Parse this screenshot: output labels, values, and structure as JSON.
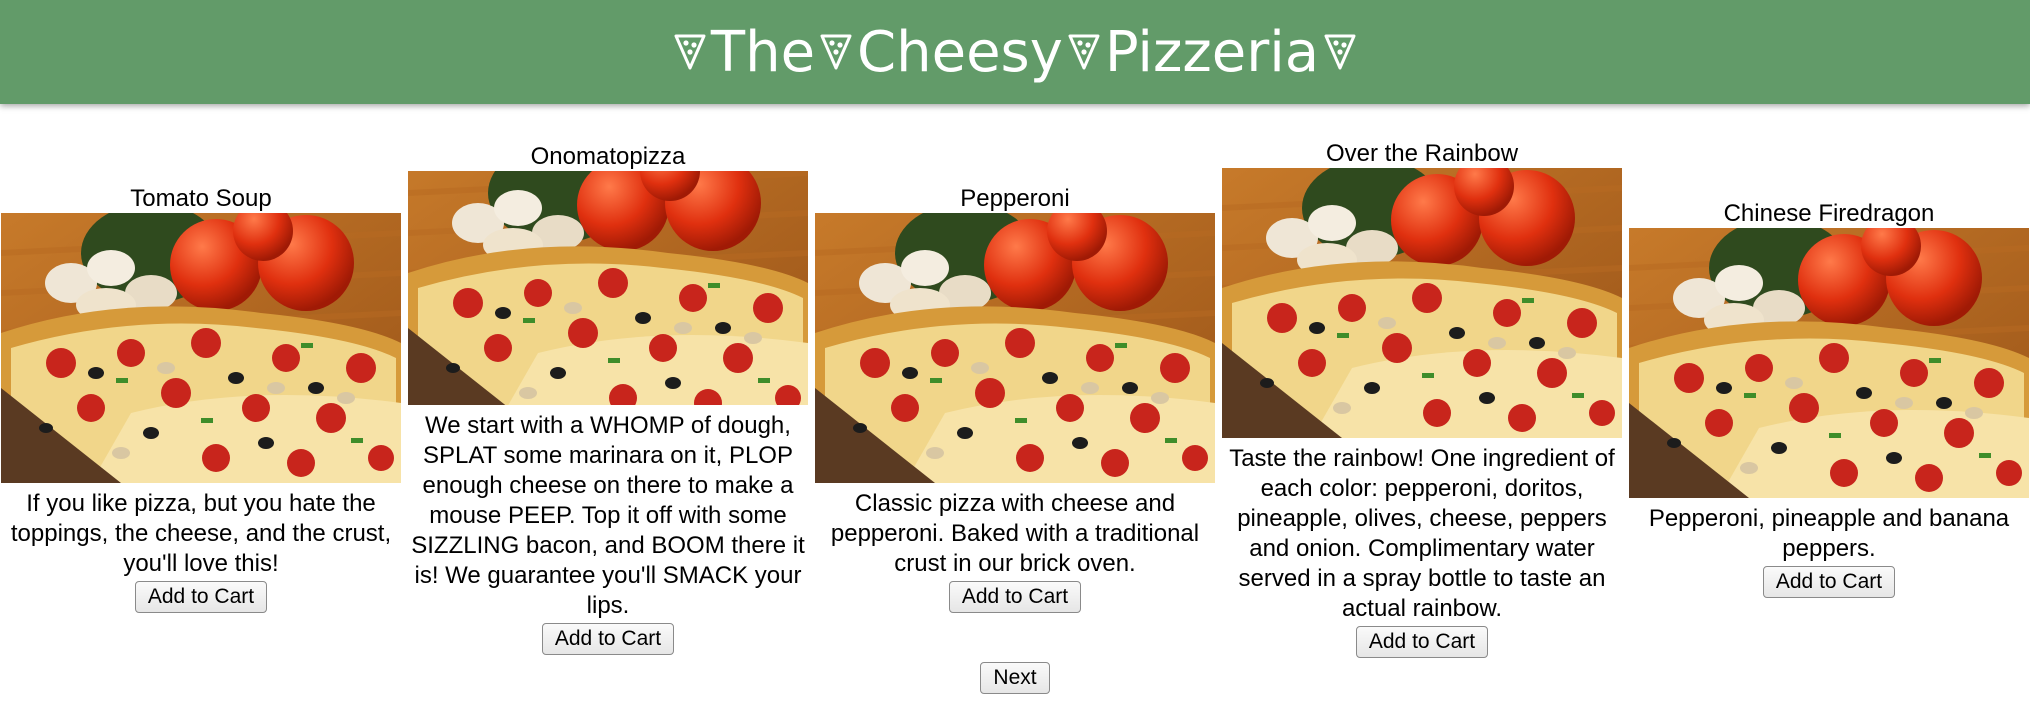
{
  "header": {
    "title_words": [
      "The",
      "Cheesy",
      "Pizzeria"
    ],
    "icon": "pizza-slice-icon",
    "background_color": "#629b69",
    "text_color": "#ffffff"
  },
  "pizzas": [
    {
      "name": "Tomato Soup",
      "description": "If you like pizza, but you hate the toppings, the cheese, and the crust, you'll love this!",
      "button_label": "Add to Cart"
    },
    {
      "name": "Onomatopizza",
      "description": "We start with a WHOMP of dough, SPLAT some marinara on it, PLOP enough cheese on there to make a mouse PEEP. Top it off with some SIZZLING bacon, and BOOM there it is! We guarantee you'll SMACK your lips.",
      "button_label": "Add to Cart"
    },
    {
      "name": "Pepperoni",
      "description": "Classic pizza with cheese and pepperoni. Baked with a traditional crust in our brick oven.",
      "button_label": "Add to Cart"
    },
    {
      "name": "Over the Rainbow",
      "description": "Taste the rainbow! One ingredient of each color: pepperoni, doritos, pineapple, olives, cheese, peppers and onion. Complimentary water served in a spray bottle to taste an actual rainbow.",
      "button_label": "Add to Cart"
    },
    {
      "name": "Chinese Firedragon",
      "description": "Pepperoni, pineapple and banana peppers.",
      "button_label": "Add to Cart"
    }
  ],
  "pagination": {
    "next_label": "Next"
  }
}
